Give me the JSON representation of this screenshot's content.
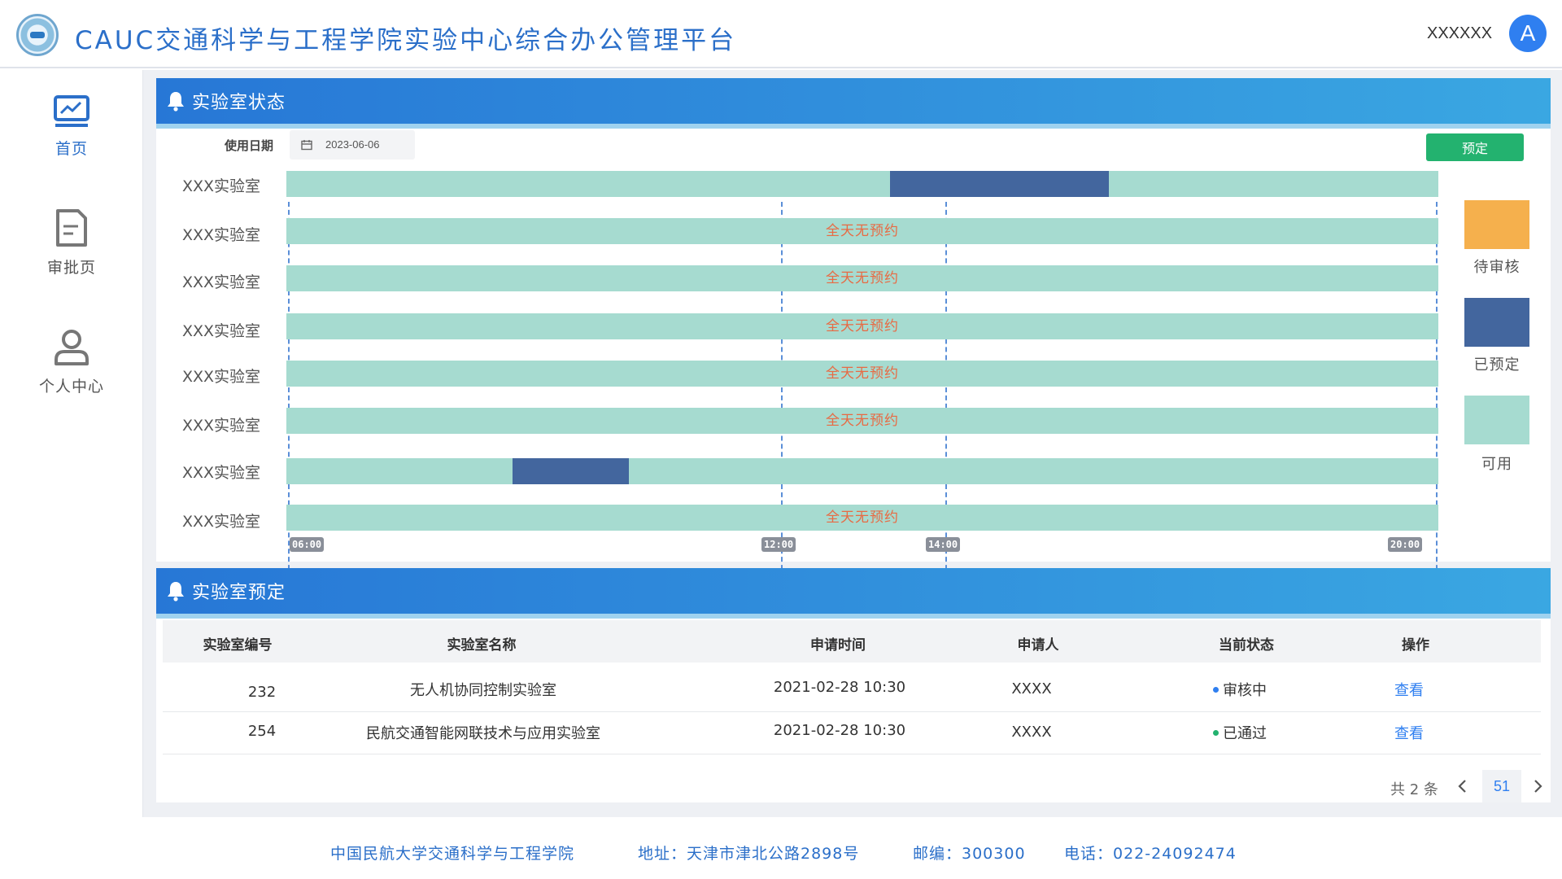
{
  "header": {
    "title": "CAUC交通科学与工程学院实验中心综合办公管理平台",
    "user_name": "XXXXXX",
    "avatar_letter": "A"
  },
  "sidebar": {
    "items": [
      {
        "label": "首页",
        "icon": "monitor-chart-icon",
        "active": true
      },
      {
        "label": "审批页",
        "icon": "document-icon",
        "active": false
      },
      {
        "label": "个人中心",
        "icon": "user-icon",
        "active": false
      }
    ]
  },
  "status_panel": {
    "title": "实验室状态",
    "date_label": "使用日期",
    "date_value": "2023-06-06",
    "reserve_button": "预定",
    "labs": [
      {
        "name": "XXX实验室",
        "text": "",
        "bookings": [
          {
            "start": "13:20",
            "end": "16:00"
          }
        ]
      },
      {
        "name": "XXX实验室",
        "text": "全天无预约",
        "bookings": []
      },
      {
        "name": "XXX实验室",
        "text": "全天无预约",
        "bookings": []
      },
      {
        "name": "XXX实验室",
        "text": "全天无预约",
        "bookings": []
      },
      {
        "name": "XXX实验室",
        "text": "全天无预约",
        "bookings": []
      },
      {
        "name": "XXX实验室",
        "text": "全天无预约",
        "bookings": []
      },
      {
        "name": "XXX实验室",
        "text": "",
        "bookings": [
          {
            "start": "08:45",
            "end": "10:10"
          }
        ]
      },
      {
        "name": "XXX实验室",
        "text": "全天无预约",
        "bookings": []
      }
    ],
    "time_marks": [
      "06:00",
      "12:00",
      "14:00",
      "20:00"
    ],
    "time_range": {
      "start": "06:00",
      "end": "20:00"
    },
    "legend": [
      {
        "label": "待审核",
        "color": "#f5b04d"
      },
      {
        "label": "已预定",
        "color": "#43669e"
      },
      {
        "label": "可用",
        "color": "#a6dbd0"
      }
    ]
  },
  "booking_panel": {
    "title": "实验室预定",
    "columns": [
      "实验室编号",
      "实验室名称",
      "申请时间",
      "申请人",
      "当前状态",
      "操作"
    ],
    "rows": [
      {
        "id": "232",
        "name": "无人机协同控制实验室",
        "time": "2021-02-28  10:30",
        "applicant": "XXXX",
        "status": "审核中",
        "status_color": "#2f7ff0",
        "action": "查看"
      },
      {
        "id": "254",
        "name": "民航交通智能网联技术与应用实验室",
        "time": "2021-02-28  10:30",
        "applicant": "XXXX",
        "status": "已通过",
        "status_color": "#23b26f",
        "action": "查看"
      }
    ],
    "pager": {
      "total": "共 2 条",
      "page": "51"
    }
  },
  "footer": {
    "school": "中国民航大学交通科学与工程学院",
    "address": "地址：天津市津北公路2898号",
    "postcode": "邮编：300300",
    "phone": "电话：022-24092474"
  },
  "colors": {
    "accent": "#2b6fc9",
    "available": "#a6dbd0",
    "booked": "#43669e",
    "pending": "#f5b04d",
    "success": "#23b26f"
  }
}
